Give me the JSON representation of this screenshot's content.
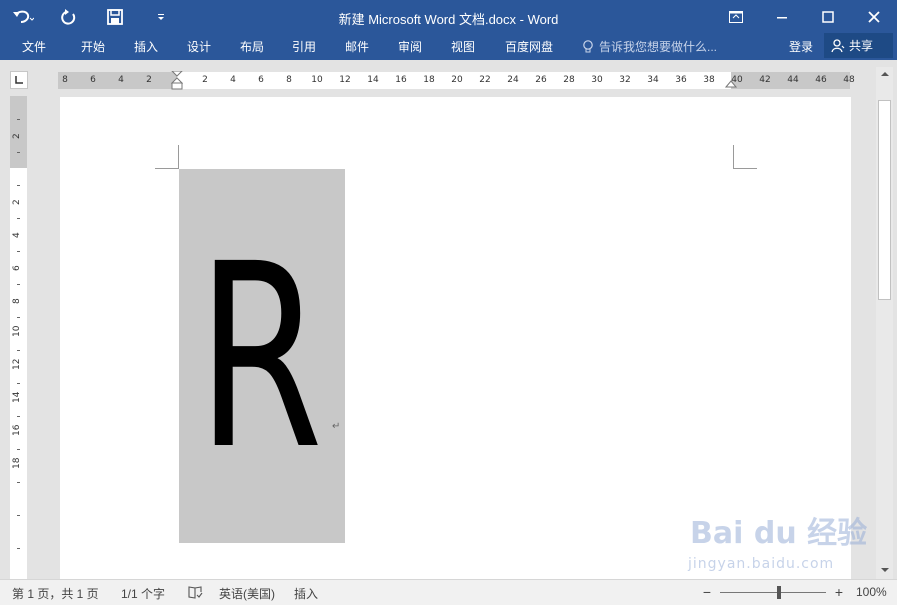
{
  "window": {
    "title": "新建 Microsoft Word 文档.docx - Word"
  },
  "ribbon": {
    "tabs": [
      "文件",
      "开始",
      "插入",
      "设计",
      "布局",
      "引用",
      "邮件",
      "审阅",
      "视图",
      "百度网盘"
    ],
    "tell_me": "告诉我您想要做什么...",
    "sign_in": "登录",
    "share": "共享"
  },
  "ruler": {
    "horizontal_left": [
      "8",
      "6",
      "4",
      "2"
    ],
    "horizontal_right": [
      "2",
      "4",
      "6",
      "8",
      "10",
      "12",
      "14",
      "16",
      "18",
      "20",
      "22",
      "24",
      "26",
      "28",
      "30",
      "32",
      "34",
      "36",
      "38",
      "40",
      "42",
      "44",
      "46",
      "48"
    ],
    "vertical_top": [
      "2"
    ],
    "vertical": [
      "2",
      "4",
      "6",
      "8",
      "10",
      "12",
      "14",
      "16",
      "18"
    ]
  },
  "document": {
    "textbox_text": "R"
  },
  "statusbar": {
    "page_info": "第 1 页，共 1 页",
    "word_count": "1/1 个字",
    "language": "英语(美国)",
    "mode": "插入",
    "zoom": "100%"
  },
  "watermark": {
    "brand": "Bai du 经验",
    "url": "jingyan.baidu.com"
  },
  "colors": {
    "accent": "#2b579a",
    "textbox_fill": "#c8c8c8"
  }
}
